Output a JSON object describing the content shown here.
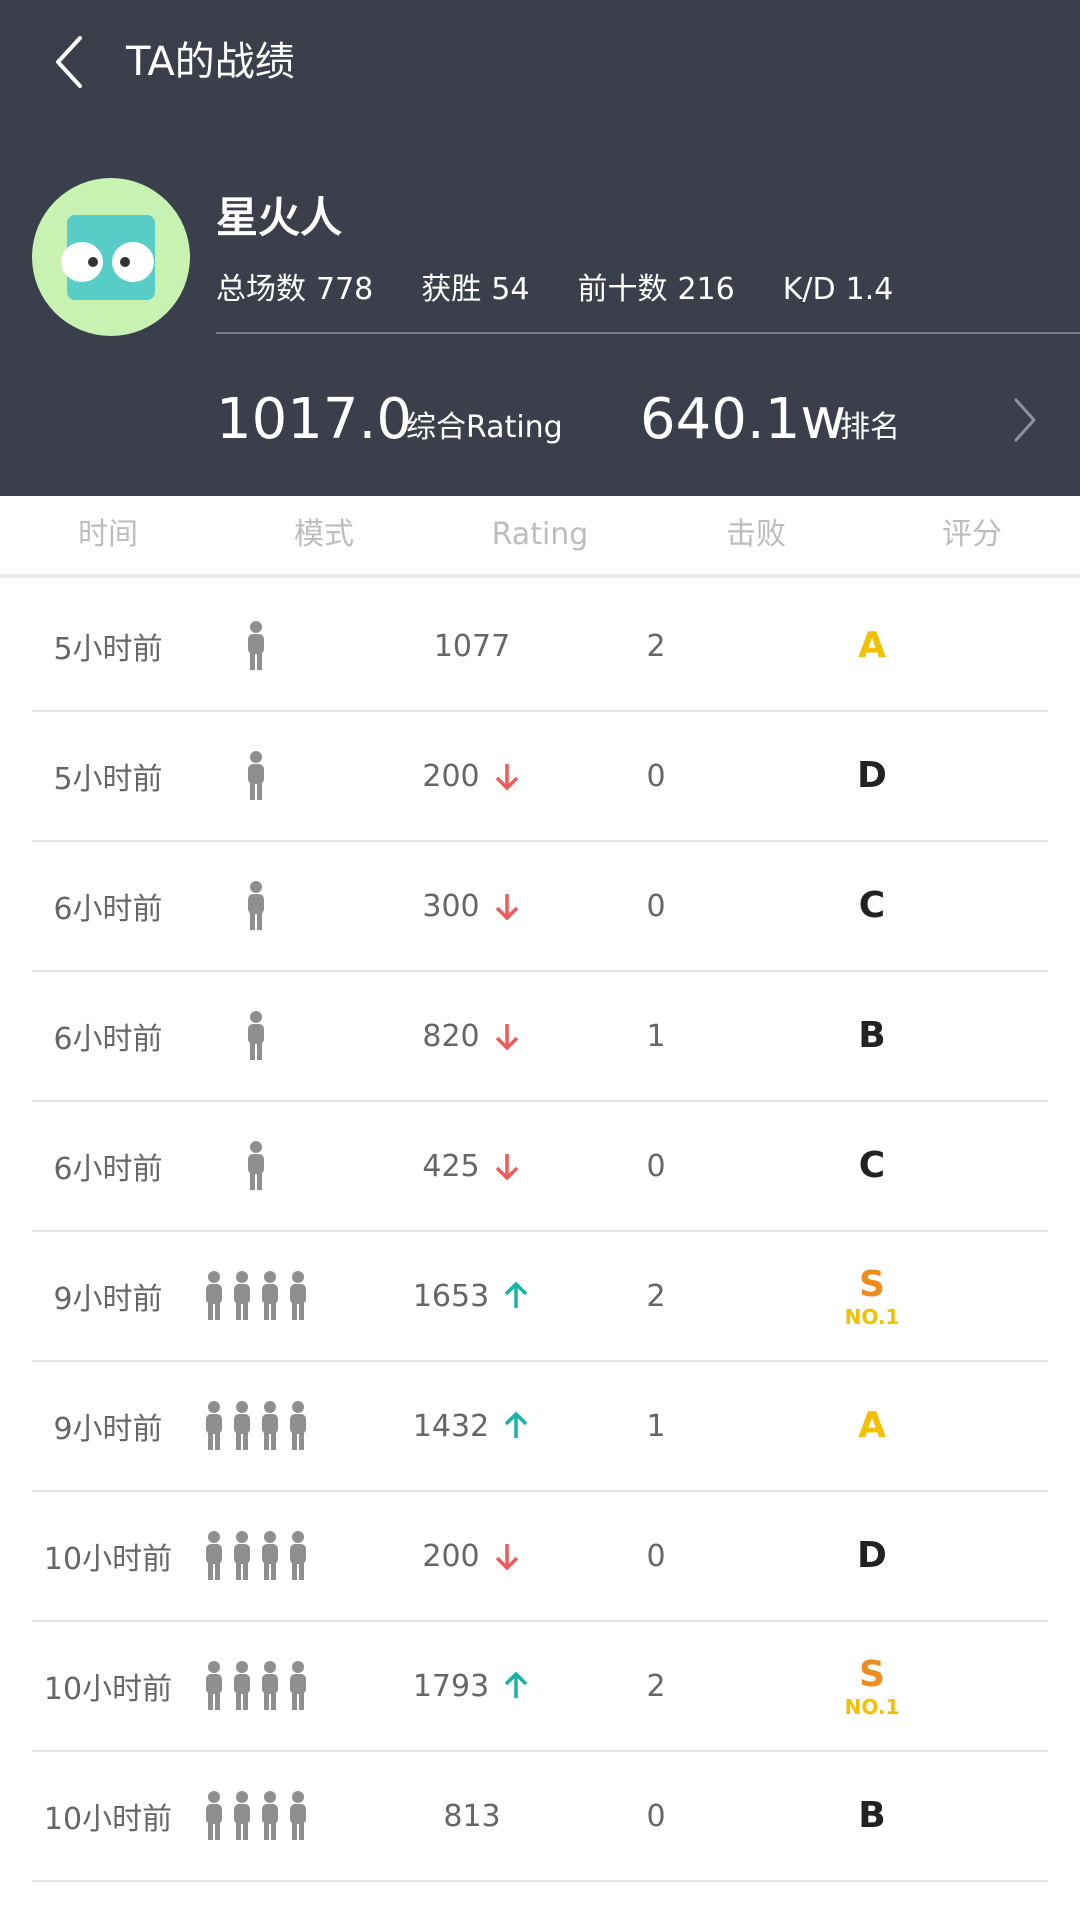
{
  "header": {
    "title": "TA的战绩",
    "username": "星火人",
    "stats": [
      {
        "label": "总场数",
        "value": "778"
      },
      {
        "label": "获胜",
        "value": "54"
      },
      {
        "label": "前十数",
        "value": "216"
      },
      {
        "label": "K/D",
        "value": "1.4"
      }
    ],
    "rating_value": "1017.0",
    "rating_label": "综合Rating",
    "rank_value": "640.1w",
    "rank_label": "排名"
  },
  "table": {
    "columns": [
      "时间",
      "模式",
      "Rating",
      "击败",
      "评分"
    ],
    "rows": [
      {
        "time": "5小时前",
        "mode": "solo",
        "rating": "1077",
        "trend": "",
        "kills": "2",
        "grade": "A",
        "grade_color": "#f3c000",
        "grade_sub": ""
      },
      {
        "time": "5小时前",
        "mode": "solo",
        "rating": "200",
        "trend": "down",
        "kills": "0",
        "grade": "D",
        "grade_color": "#222222",
        "grade_sub": ""
      },
      {
        "time": "6小时前",
        "mode": "solo",
        "rating": "300",
        "trend": "down",
        "kills": "0",
        "grade": "C",
        "grade_color": "#222222",
        "grade_sub": ""
      },
      {
        "time": "6小时前",
        "mode": "solo",
        "rating": "820",
        "trend": "down",
        "kills": "1",
        "grade": "B",
        "grade_color": "#222222",
        "grade_sub": ""
      },
      {
        "time": "6小时前",
        "mode": "solo",
        "rating": "425",
        "trend": "down",
        "kills": "0",
        "grade": "C",
        "grade_color": "#222222",
        "grade_sub": ""
      },
      {
        "time": "9小时前",
        "mode": "squad",
        "rating": "1653",
        "trend": "up",
        "kills": "2",
        "grade": "S",
        "grade_color": "#f08c1e",
        "grade_sub": "NO.1"
      },
      {
        "time": "9小时前",
        "mode": "squad",
        "rating": "1432",
        "trend": "up",
        "kills": "1",
        "grade": "A",
        "grade_color": "#f3c000",
        "grade_sub": ""
      },
      {
        "time": "10小时前",
        "mode": "squad",
        "rating": "200",
        "trend": "down",
        "kills": "0",
        "grade": "D",
        "grade_color": "#222222",
        "grade_sub": ""
      },
      {
        "time": "10小时前",
        "mode": "squad",
        "rating": "1793",
        "trend": "up",
        "kills": "2",
        "grade": "S",
        "grade_color": "#f08c1e",
        "grade_sub": "NO.1"
      },
      {
        "time": "10小时前",
        "mode": "squad",
        "rating": "813",
        "trend": "",
        "kills": "0",
        "grade": "B",
        "grade_color": "#222222",
        "grade_sub": ""
      }
    ]
  },
  "colors": {
    "header_bg": "#3b3f4b",
    "trend_up": "#16b3a8",
    "trend_down": "#ef5b5b"
  },
  "icons": {
    "back": "chevron-left-icon",
    "rank": "chevron-right-icon",
    "solo": "person-icon",
    "squad": "group-icon",
    "trend_up": "arrow-up-icon",
    "trend_down": "arrow-down-icon"
  }
}
